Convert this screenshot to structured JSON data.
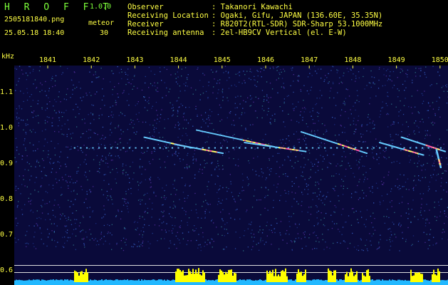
{
  "header": {
    "app_name": "H R O F F T",
    "app_version": "1.0.0",
    "file_name": "2505181840.png",
    "datetime": "25.05.18 18:40",
    "meteor_label": "meteor",
    "meteor_count": "30",
    "info": [
      {
        "key": "Observer",
        "value": ": Takanori Kawachi"
      },
      {
        "key": "Receiving Location",
        "value": ": Ogaki, Gifu, JAPAN (136.60E, 35.35N)"
      },
      {
        "key": "Receiver",
        "value": ": R820T2(RTL-SDR) SDR-Sharp 53.1000MHz"
      },
      {
        "key": "Receiving antenna",
        "value": ": 2el-HB9CV Vertical (el. E-W)"
      }
    ]
  },
  "chart_data": {
    "type": "heatmap",
    "ylabel": "kHz",
    "x_ticks": [
      "1841",
      "1842",
      "1843",
      "1844",
      "1845",
      "1846",
      "1847",
      "1848",
      "1849",
      "1850"
    ],
    "y_ticks": [
      "1.1",
      "1.0",
      "0.9",
      "0.8",
      "0.7",
      "0.6"
    ],
    "ylim": [
      0.58,
      1.18
    ],
    "carrier_khz": 0.945,
    "meteor_traces": [
      {
        "x_start": 1841.6,
        "x_end": 1850.0,
        "y_start": 0.945,
        "y_end": 0.945
      },
      {
        "x_start": 1843.2,
        "x_end": 1844.3,
        "y_start": 0.975,
        "y_end": 0.945
      },
      {
        "x_start": 1843.9,
        "x_end": 1845.0,
        "y_start": 0.955,
        "y_end": 0.93
      },
      {
        "x_start": 1844.4,
        "x_end": 1846.3,
        "y_start": 0.995,
        "y_end": 0.945
      },
      {
        "x_start": 1845.5,
        "x_end": 1846.9,
        "y_start": 0.96,
        "y_end": 0.935
      },
      {
        "x_start": 1846.8,
        "x_end": 1848.3,
        "y_start": 0.99,
        "y_end": 0.93
      },
      {
        "x_start": 1848.6,
        "x_end": 1849.6,
        "y_start": 0.96,
        "y_end": 0.925
      },
      {
        "x_start": 1849.1,
        "x_end": 1850.1,
        "y_start": 0.975,
        "y_end": 0.935
      },
      {
        "x_start": 1849.9,
        "x_end": 1850.0,
        "y_start": 0.94,
        "y_end": 0.89
      }
    ],
    "colors": {
      "background": "#0a0a3a",
      "noise": "#2a4aa0",
      "trace": "#66ccff",
      "trace_hot": "#ff55aa",
      "bars": "#ffff00",
      "bar_base": "#22b8ff",
      "guide": "#dddddd"
    }
  }
}
